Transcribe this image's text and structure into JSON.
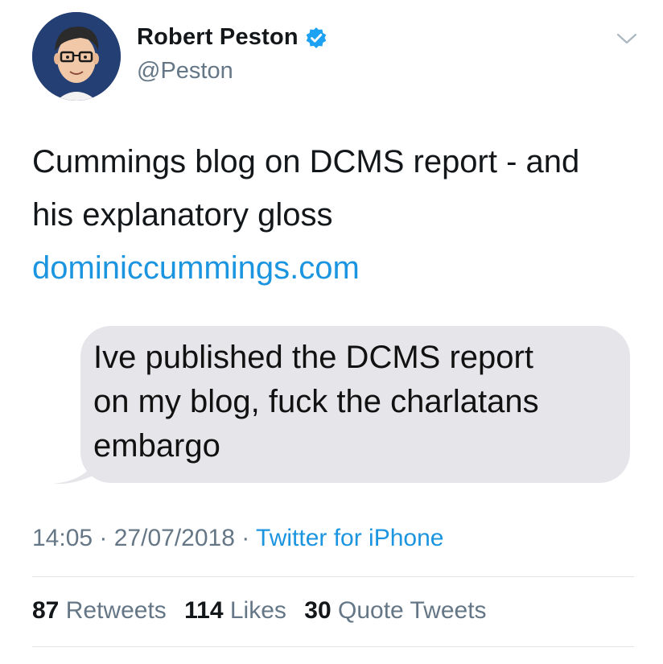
{
  "user": {
    "display_name": "Robert Peston",
    "handle": "@Peston",
    "verified_icon": "verified-badge-icon",
    "menu_icon": "chevron-down-icon"
  },
  "tweet": {
    "line1": "Cummings blog on DCMS report - and",
    "line2": "his explanatory gloss",
    "link": "dominiccummings.com",
    "message_bubble": {
      "line1": "Ive published the DCMS report",
      "line2": "on my blog, fuck the charlatans",
      "line3": "embargo"
    }
  },
  "meta": {
    "time": "14:05",
    "sep1": " · ",
    "date": "27/07/2018",
    "sep2": " · ",
    "source": "Twitter for iPhone"
  },
  "stats": {
    "retweets_count": "87",
    "retweets_label": "Retweets",
    "likes_count": "114",
    "likes_label": "Likes",
    "quotes_count": "30",
    "quotes_label": "Quote Tweets"
  },
  "colors": {
    "link_blue": "#1b95e0",
    "secondary_text": "#657786",
    "bubble_grey": "#e5e5ea",
    "avatar_bg": "#243f73"
  }
}
